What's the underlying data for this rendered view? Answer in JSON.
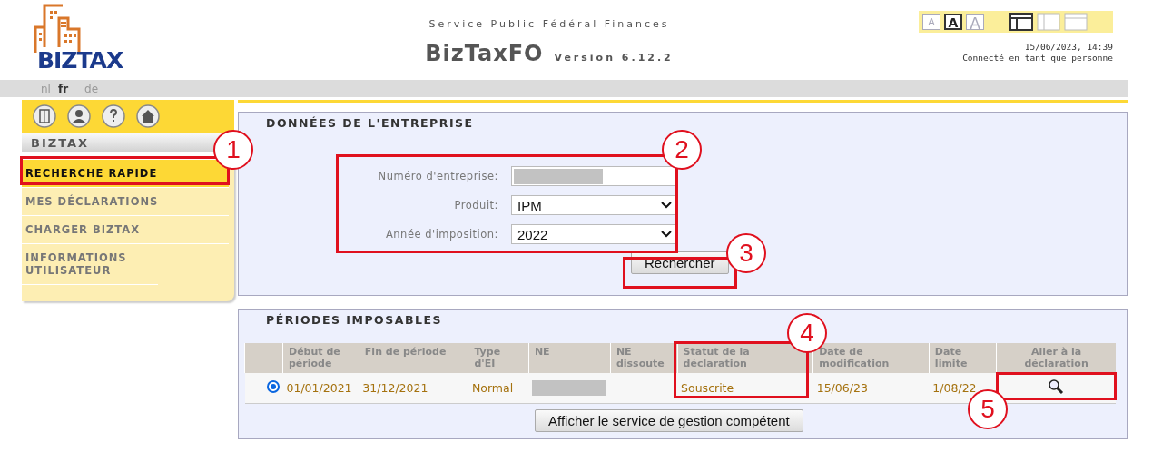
{
  "logo": {
    "text": "BIZTAX"
  },
  "header": {
    "agency": "Service Public Fédéral Finances",
    "app_name": "BizTaxFO",
    "version": "Version 6.12.2",
    "datetime": "15/06/2023, 14:39",
    "user": "Connecté en tant que personne"
  },
  "text_sizes": [
    {
      "label": "A",
      "selected": false
    },
    {
      "label": "A",
      "selected": true
    },
    {
      "label": "A",
      "selected": false
    }
  ],
  "layouts": [
    {
      "kind": "header-sidebar",
      "selected": true
    },
    {
      "kind": "sidebar",
      "selected": false
    },
    {
      "kind": "header",
      "selected": false
    }
  ],
  "languages": [
    {
      "label": "nl",
      "selected": false
    },
    {
      "label": "fr",
      "selected": true
    },
    {
      "label": "de",
      "selected": false
    }
  ],
  "sidebar": {
    "tools": [
      {
        "kind": "exit"
      },
      {
        "kind": "user"
      },
      {
        "kind": "help"
      },
      {
        "kind": "home"
      }
    ],
    "section": "BIZTAX",
    "items": [
      {
        "label": "RECHERCHE RAPIDE",
        "selected": true
      },
      {
        "label": "MES DÉCLARATIONS",
        "selected": false
      },
      {
        "label": "CHARGER BIZTAX",
        "selected": false
      },
      {
        "label": "INFORMATIONS UTILISATEUR",
        "selected": false
      }
    ]
  },
  "company": {
    "title": "DONNÉES DE L'ENTREPRISE",
    "fields": [
      {
        "kind": "text",
        "label": "Numéro d'entreprise:",
        "redacted": true
      },
      {
        "kind": "select",
        "label": "Produit:",
        "value": "IPM"
      },
      {
        "kind": "select",
        "label": "Année d'imposition:",
        "value": "2022"
      }
    ],
    "button": "Rechercher"
  },
  "periods": {
    "title": "PÉRIODES IMPOSABLES",
    "columns": [
      "Début de période",
      "Fin de période",
      "Type d'EI",
      "NE",
      "NE dissoute",
      "Statut de la déclaration",
      "Date de modification",
      "Date limite",
      "Aller à la déclaration"
    ],
    "rows": [
      {
        "selected": true,
        "cells": [
          "01/01/2021",
          "31/12/2021",
          "Normal",
          {
            "redacted": true
          },
          "",
          "Souscrite",
          "15/06/23",
          "1/08/22",
          {
            "kind": "search"
          }
        ]
      }
    ],
    "button": "Afficher le service de gestion compétent"
  },
  "annotations": [
    "1",
    "2",
    "3",
    "4",
    "5"
  ]
}
